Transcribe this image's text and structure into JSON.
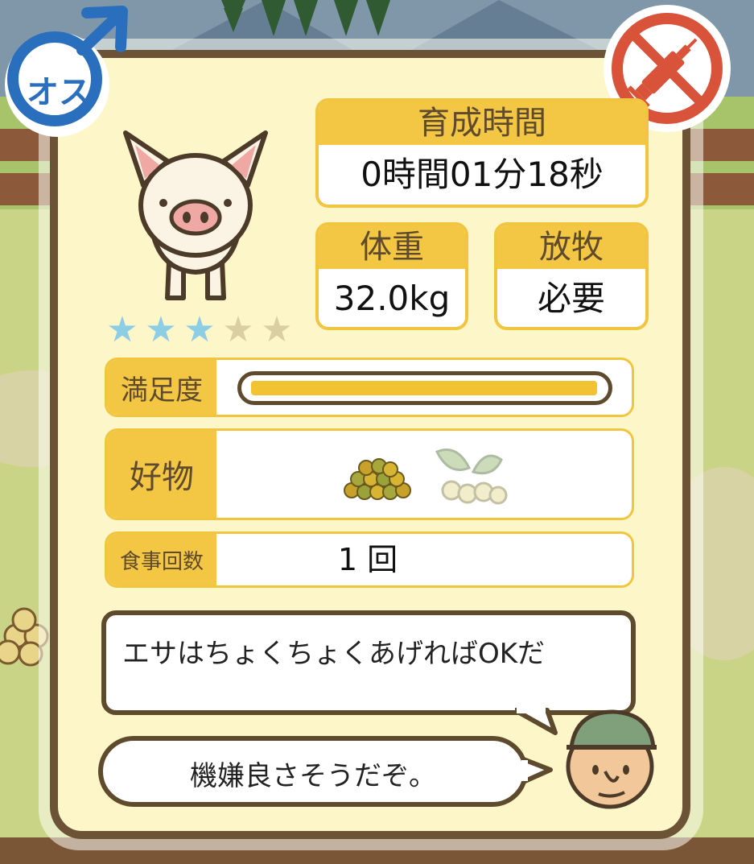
{
  "gender_badge": {
    "label": "オス",
    "color": "#2a6fbd",
    "icon": "male-symbol-icon"
  },
  "vaccine_badge": {
    "icon": "no-syringe-icon",
    "color": "#d9533a"
  },
  "pig": {
    "icon": "pig-icon",
    "rating": 3,
    "rating_max": 5,
    "star_on_color": "#8ecde6",
    "star_off_color": "#d9cfa3"
  },
  "stats": {
    "growth_time": {
      "label": "育成時間",
      "value": "0時間01分18秒"
    },
    "weight": {
      "label": "体重",
      "value": "32.0kg"
    },
    "grazing": {
      "label": "放牧",
      "value": "必要"
    }
  },
  "satisfaction": {
    "label": "満足度",
    "level": 1.0,
    "fill_color": "#f1c232"
  },
  "favorites": {
    "label": "好物",
    "items": [
      "grain-pile-icon",
      "soybean-icon"
    ]
  },
  "meals": {
    "label": "食事回数",
    "value": "1 回"
  },
  "farmer": {
    "icon": "farmer-face-icon",
    "speech_main": "エサはちょくちょくあげればOKだ",
    "speech_mood": "機嫌良さそうだぞ。"
  },
  "accent_color": "#f3c644",
  "frame_color": "#6d5335"
}
